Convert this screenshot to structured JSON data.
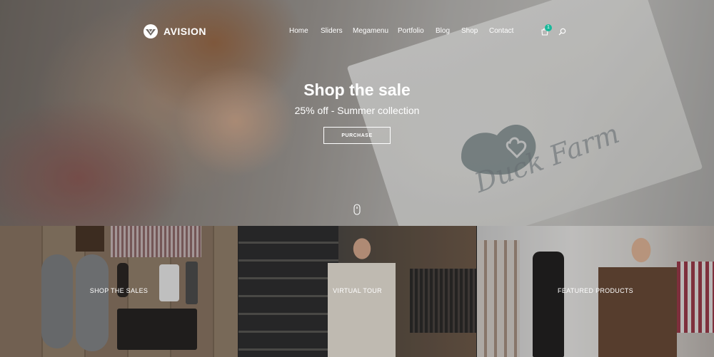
{
  "brand": {
    "name": "AVISION"
  },
  "nav": {
    "items": [
      "Home",
      "Sliders",
      "Megamenu",
      "Portfolio",
      "Blog",
      "Shop",
      "Contact"
    ],
    "cart_count": "1",
    "icons": [
      "cart-icon",
      "search-icon"
    ]
  },
  "hero": {
    "title": "Shop the sale",
    "subtitle": "25% off - Summer collection",
    "button": "PURCHASE",
    "background_text": "Duck Farm"
  },
  "tiles": [
    {
      "label": "SHOP THE SALES"
    },
    {
      "label": "VIRTUAL TOUR"
    },
    {
      "label": "FEATURED PRODUCTS"
    }
  ],
  "colors": {
    "accent": "#18b89a",
    "text": "#ffffff"
  }
}
